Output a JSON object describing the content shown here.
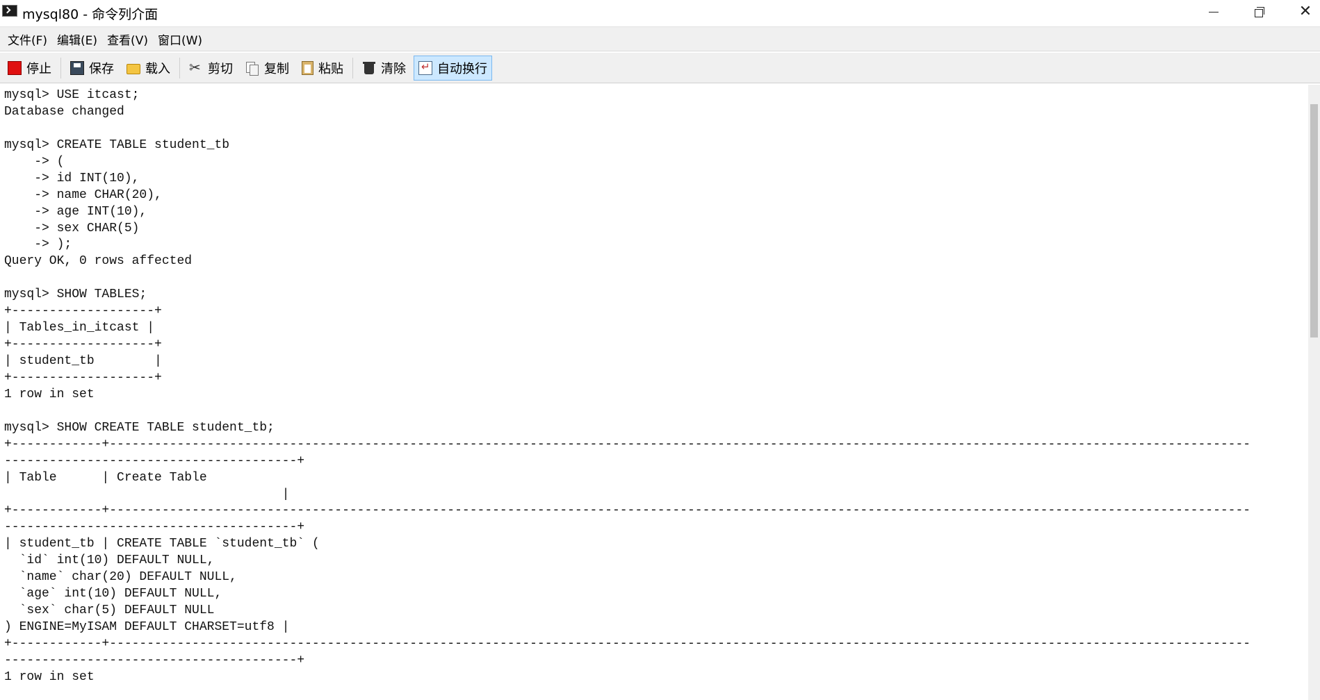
{
  "window": {
    "title": "mysql80 - 命令列介面",
    "icon": "terminal-icon",
    "controls": {
      "minimize": "minimize-icon",
      "maximize": "restore-icon",
      "close": "close-icon"
    }
  },
  "menu": [
    {
      "label": "文件(F)"
    },
    {
      "label": "编辑(E)"
    },
    {
      "label": "查看(V)"
    },
    {
      "label": "窗口(W)"
    }
  ],
  "toolbar": {
    "stop": {
      "label": "停止",
      "icon": "stop-icon"
    },
    "save": {
      "label": "保存",
      "icon": "save-icon"
    },
    "load": {
      "label": "载入",
      "icon": "folder-icon"
    },
    "cut": {
      "label": "剪切",
      "icon": "scissors-icon"
    },
    "copy": {
      "label": "复制",
      "icon": "copy-icon"
    },
    "paste": {
      "label": "粘贴",
      "icon": "paste-icon"
    },
    "clear": {
      "label": "清除",
      "icon": "trash-icon"
    },
    "wrap": {
      "label": "自动换行",
      "icon": "word-wrap-icon",
      "active": true
    }
  },
  "console": {
    "lines": [
      "mysql> USE itcast;",
      "Database changed",
      "",
      "mysql> CREATE TABLE student_tb",
      "    -> (",
      "    -> id INT(10),",
      "    -> name CHAR(20),",
      "    -> age INT(10),",
      "    -> sex CHAR(5)",
      "    -> );",
      "Query OK, 0 rows affected",
      "",
      "mysql> SHOW TABLES;",
      "+-------------------+",
      "| Tables_in_itcast |",
      "+-------------------+",
      "| student_tb        |",
      "+-------------------+",
      "1 row in set",
      "",
      "mysql> SHOW CREATE TABLE student_tb;",
      "+------------+--------------------------------------------------------------------------------------------------------------------------------------------------------",
      "---------------------------------------+",
      "| Table      | Create Table",
      "                                     |",
      "+------------+--------------------------------------------------------------------------------------------------------------------------------------------------------",
      "---------------------------------------+",
      "| student_tb | CREATE TABLE `student_tb` (",
      "  `id` int(10) DEFAULT NULL,",
      "  `name` char(20) DEFAULT NULL,",
      "  `age` int(10) DEFAULT NULL,",
      "  `sex` char(5) DEFAULT NULL",
      ") ENGINE=MyISAM DEFAULT CHARSET=utf8 |",
      "+------------+--------------------------------------------------------------------------------------------------------------------------------------------------------",
      "---------------------------------------+",
      "1 row in set"
    ]
  }
}
